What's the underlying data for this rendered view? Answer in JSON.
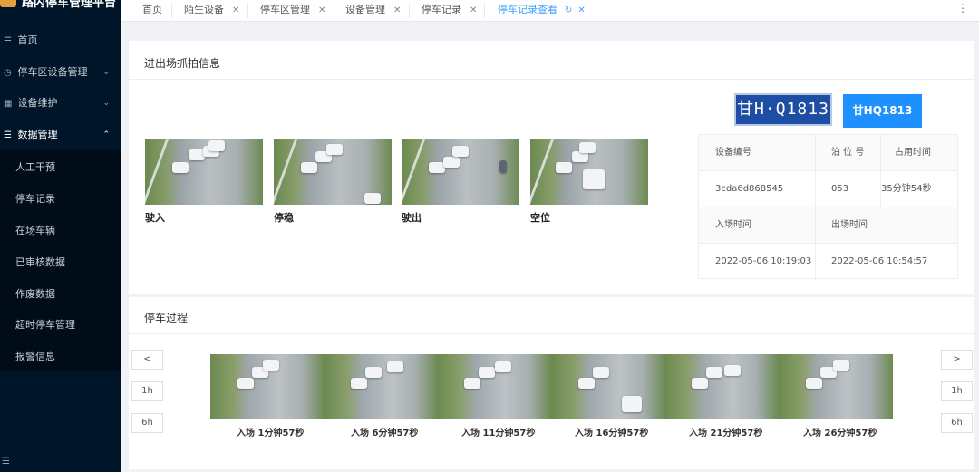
{
  "app": {
    "title": "路内停车管理平台"
  },
  "sidebar": {
    "items": [
      {
        "label": "首页",
        "icon": "list-icon"
      },
      {
        "label": "停车区设备管理",
        "icon": "clock-icon"
      },
      {
        "label": "设备维护",
        "icon": "grid-icon"
      },
      {
        "label": "数据管理",
        "icon": "list-icon"
      }
    ],
    "submenu": [
      "人工干预",
      "停车记录",
      "在场车辆",
      "已审核数据",
      "作废数据",
      "超时停车管理",
      "报警信息"
    ]
  },
  "tabs": [
    {
      "label": "首页"
    },
    {
      "label": "陌生设备"
    },
    {
      "label": "停车区管理"
    },
    {
      "label": "设备管理"
    },
    {
      "label": "停车记录"
    },
    {
      "label": "停车记录查看"
    }
  ],
  "capture": {
    "title": "进出场抓拍信息",
    "labels": [
      "驶入",
      "停稳",
      "驶出",
      "空位"
    ]
  },
  "plate": {
    "image_text": "甘H·Q1813",
    "button_text": "甘HQ1813"
  },
  "info": {
    "headers1": [
      "设备编号",
      "泊 位 号",
      "占用时间"
    ],
    "values1": [
      "3cda6d868545",
      "053",
      "35分钟54秒"
    ],
    "headers2": [
      "入场时间",
      "出场时间"
    ],
    "values2": [
      "2022-05-06 10:19:03",
      "2022-05-06 10:54:57"
    ]
  },
  "process": {
    "title": "停车过程",
    "prev": "<",
    "next": ">",
    "h1": "1h",
    "h6": "6h",
    "frames": [
      "入场 1分钟57秒",
      "入场 6分钟57秒",
      "入场 11分钟57秒",
      "入场 16分钟57秒",
      "入场 21分钟57秒",
      "入场 26分钟57秒"
    ]
  },
  "colors": {
    "sidebar": "#001529",
    "accent": "#409eff",
    "plate_button": "#1e90ff"
  }
}
